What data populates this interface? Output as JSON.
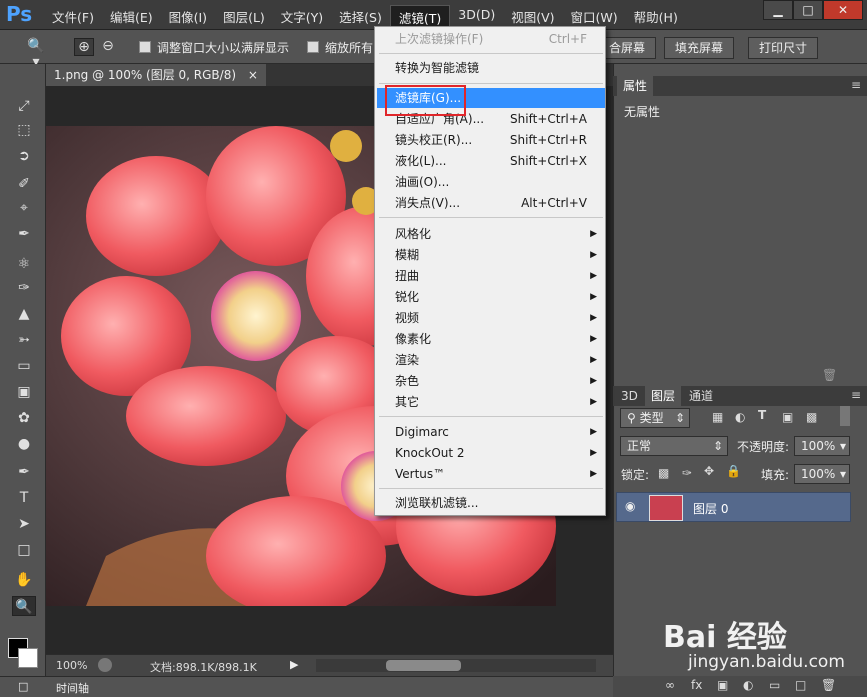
{
  "app": {
    "logo": "Ps"
  },
  "menubar": {
    "items": [
      "文件(F)",
      "编辑(E)",
      "图像(I)",
      "图层(L)",
      "文字(Y)",
      "选择(S)",
      "滤镜(T)",
      "3D(D)",
      "视图(V)",
      "窗口(W)",
      "帮助(H)"
    ],
    "active_index": 6
  },
  "window_controls": {
    "minimize": "▁",
    "restore": "□",
    "close": "✕"
  },
  "options_bar": {
    "checkbox1_label": "调整窗口大小以满屏显示",
    "checkbox2_label": "缩放所有",
    "fit_screen": "合屏幕",
    "fill_screen": "填充屏幕",
    "print_size": "打印尺寸"
  },
  "document": {
    "tab_title": "1.png @ 100% (图层 0, RGB/8)",
    "tab_close": "×",
    "zoom": "100%",
    "doc_info": "文档:898.1K/898.1K",
    "timeline_label": "时间轴"
  },
  "filter_menu": {
    "last_filter": {
      "label": "上次滤镜操作(F)",
      "shortcut": "Ctrl+F"
    },
    "convert_smart": "转换为智能滤镜",
    "group1": [
      {
        "label": "滤镜库(G)...",
        "shortcut": ""
      },
      {
        "label": "自适应广角(A)...",
        "shortcut": "Shift+Ctrl+A"
      },
      {
        "label": "镜头校正(R)...",
        "shortcut": "Shift+Ctrl+R"
      },
      {
        "label": "液化(L)...",
        "shortcut": "Shift+Ctrl+X"
      },
      {
        "label": "油画(O)...",
        "shortcut": ""
      },
      {
        "label": "消失点(V)...",
        "shortcut": "Alt+Ctrl+V"
      }
    ],
    "submenus": [
      "风格化",
      "模糊",
      "扭曲",
      "锐化",
      "视频",
      "像素化",
      "渲染",
      "杂色",
      "其它"
    ],
    "plugins": [
      "Digimarc",
      "KnockOut 2",
      "Vertus™"
    ],
    "browse": "浏览联机滤镜..."
  },
  "properties_panel": {
    "tab": "属性",
    "content": "无属性"
  },
  "layers_panel": {
    "tabs": [
      "3D",
      "图层",
      "通道"
    ],
    "active_tab": 1,
    "filter_kind": "类型",
    "blend_mode": "正常",
    "opacity_label": "不透明度:",
    "opacity_value": "100%",
    "lock_label": "锁定:",
    "fill_label": "填充:",
    "fill_value": "100%",
    "layers": [
      {
        "name": "图层 0"
      }
    ]
  },
  "watermark": {
    "logo": "Bai 经验",
    "url": "jingyan.baidu.com"
  },
  "colors": {
    "highlight": "#3390ff",
    "red_box": "#e0262a",
    "layer_selected": "#55698c"
  }
}
